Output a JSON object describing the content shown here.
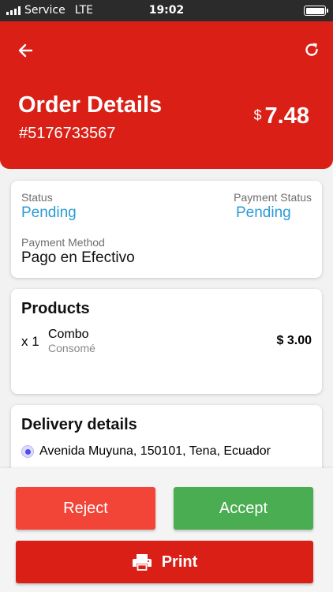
{
  "status_bar": {
    "carrier": "Service",
    "network": "LTE",
    "time": "19:02"
  },
  "header": {
    "title": "Order Details",
    "order_number": "#5176733567",
    "currency_symbol": "$",
    "total": "7.48"
  },
  "status_card": {
    "status_label": "Status",
    "status_value": "Pending",
    "payment_status_label": "Payment Status",
    "payment_status_value": "Pending",
    "payment_method_label": "Payment Method",
    "payment_method_value": "Pago en Efectivo"
  },
  "products_card": {
    "title": "Products",
    "items": [
      {
        "qty": "x 1",
        "name": "Combo",
        "sub": "Consomé",
        "price": "$ 3.00"
      }
    ]
  },
  "delivery_card": {
    "title": "Delivery details",
    "address": "Avenida Muyuna, 150101, Tena, Ecuador"
  },
  "actions": {
    "reject": "Reject",
    "accept": "Accept",
    "print": "Print"
  },
  "colors": {
    "primary_red": "#d91f16",
    "reject_red": "#f24437",
    "accept_green": "#4aad52",
    "status_blue": "#2a9bd6"
  },
  "icons": {
    "back": "arrow-left-icon",
    "refresh": "refresh-icon",
    "print": "printer-icon"
  }
}
